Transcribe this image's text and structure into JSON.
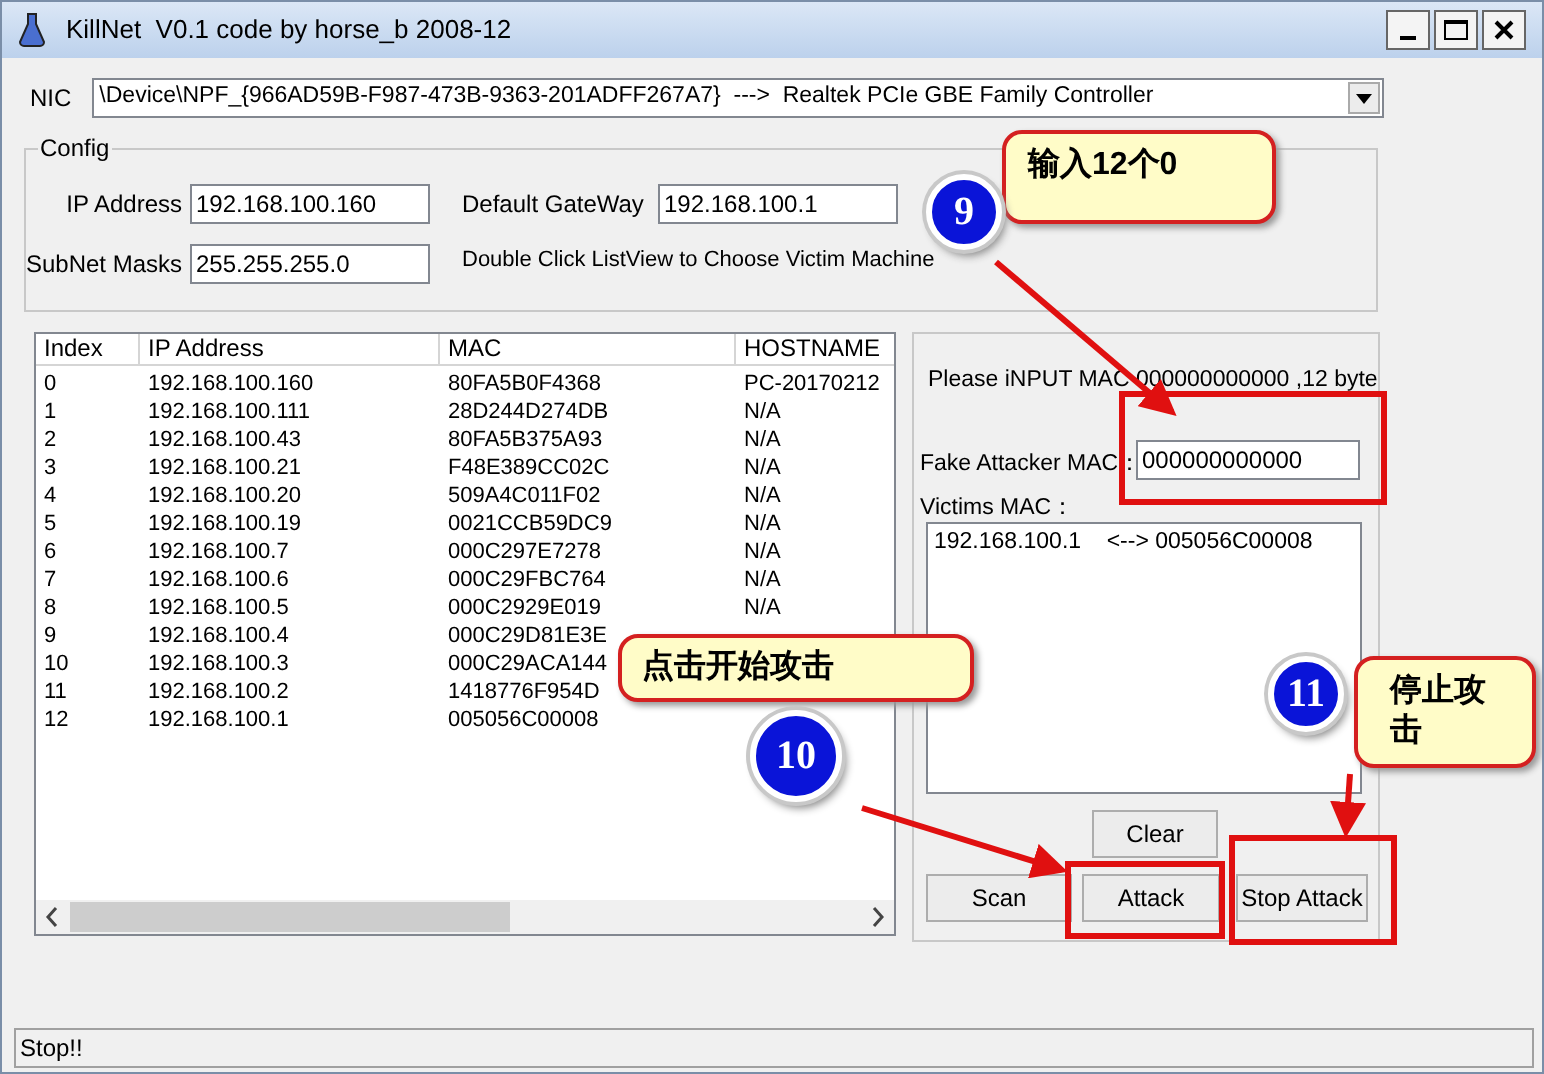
{
  "window": {
    "title": "KillNet  V0.1 code by horse_b 2008-12"
  },
  "nic": {
    "label": "NIC",
    "value": "\\Device\\NPF_{966AD59B-F987-473B-9363-201ADFF267A7}  --->  Realtek PCIe GBE Family Controller"
  },
  "config": {
    "title": "Config",
    "fields": [
      {
        "label": "IP Address",
        "value": "192.168.100.160"
      },
      {
        "label": "SubNet Masks",
        "value": "255.255.255.0"
      },
      {
        "label": "Default GateWay",
        "value": "192.168.100.1"
      }
    ],
    "hint": "Double Click ListView to Choose Victim Machine"
  },
  "table": {
    "columns": [
      "Index",
      "IP Address",
      "MAC",
      "HOSTNAME"
    ],
    "rows": [
      [
        "0",
        "192.168.100.160",
        "80FA5B0F4368",
        "PC-20170212"
      ],
      [
        "1",
        "192.168.100.111",
        "28D244D274DB",
        "N/A"
      ],
      [
        "2",
        "192.168.100.43",
        "80FA5B375A93",
        "N/A"
      ],
      [
        "3",
        "192.168.100.21",
        "F48E389CC02C",
        "N/A"
      ],
      [
        "4",
        "192.168.100.20",
        "509A4C011F02",
        "N/A"
      ],
      [
        "5",
        "192.168.100.19",
        "0021CCB59DC9",
        "N/A"
      ],
      [
        "6",
        "192.168.100.7",
        "000C297E7278",
        "N/A"
      ],
      [
        "7",
        "192.168.100.6",
        "000C29FBC764",
        "N/A"
      ],
      [
        "8",
        "192.168.100.5",
        "000C2929E019",
        "N/A"
      ],
      [
        "9",
        "192.168.100.4",
        "000C29D81E3E"
      ],
      [
        "10",
        "192.168.100.3",
        "000C29ACA144"
      ],
      [
        "11",
        "192.168.100.2",
        "1418776F954D"
      ],
      [
        "12",
        "192.168.100.1",
        "005056C00008"
      ]
    ]
  },
  "attack_panel": {
    "instruction": "Please iNPUT MAC 000000000000 ,12 byte",
    "fake_mac": {
      "label": "Fake Attacker MAC：",
      "value": "000000000000"
    },
    "victims_label": "Victims MAC：",
    "victims": [
      "192.168.100.1    <--> 005056C00008"
    ],
    "buttons": {
      "clear": "Clear",
      "scan": "Scan",
      "attack": "Attack",
      "stop": "Stop Attack"
    }
  },
  "status_bar": "Stop!!",
  "annotations": [
    {
      "number": "9",
      "text": "输入12个0"
    },
    {
      "number": "10",
      "text": "点击开始攻击"
    },
    {
      "number": "11",
      "text": "停止攻击"
    }
  ]
}
